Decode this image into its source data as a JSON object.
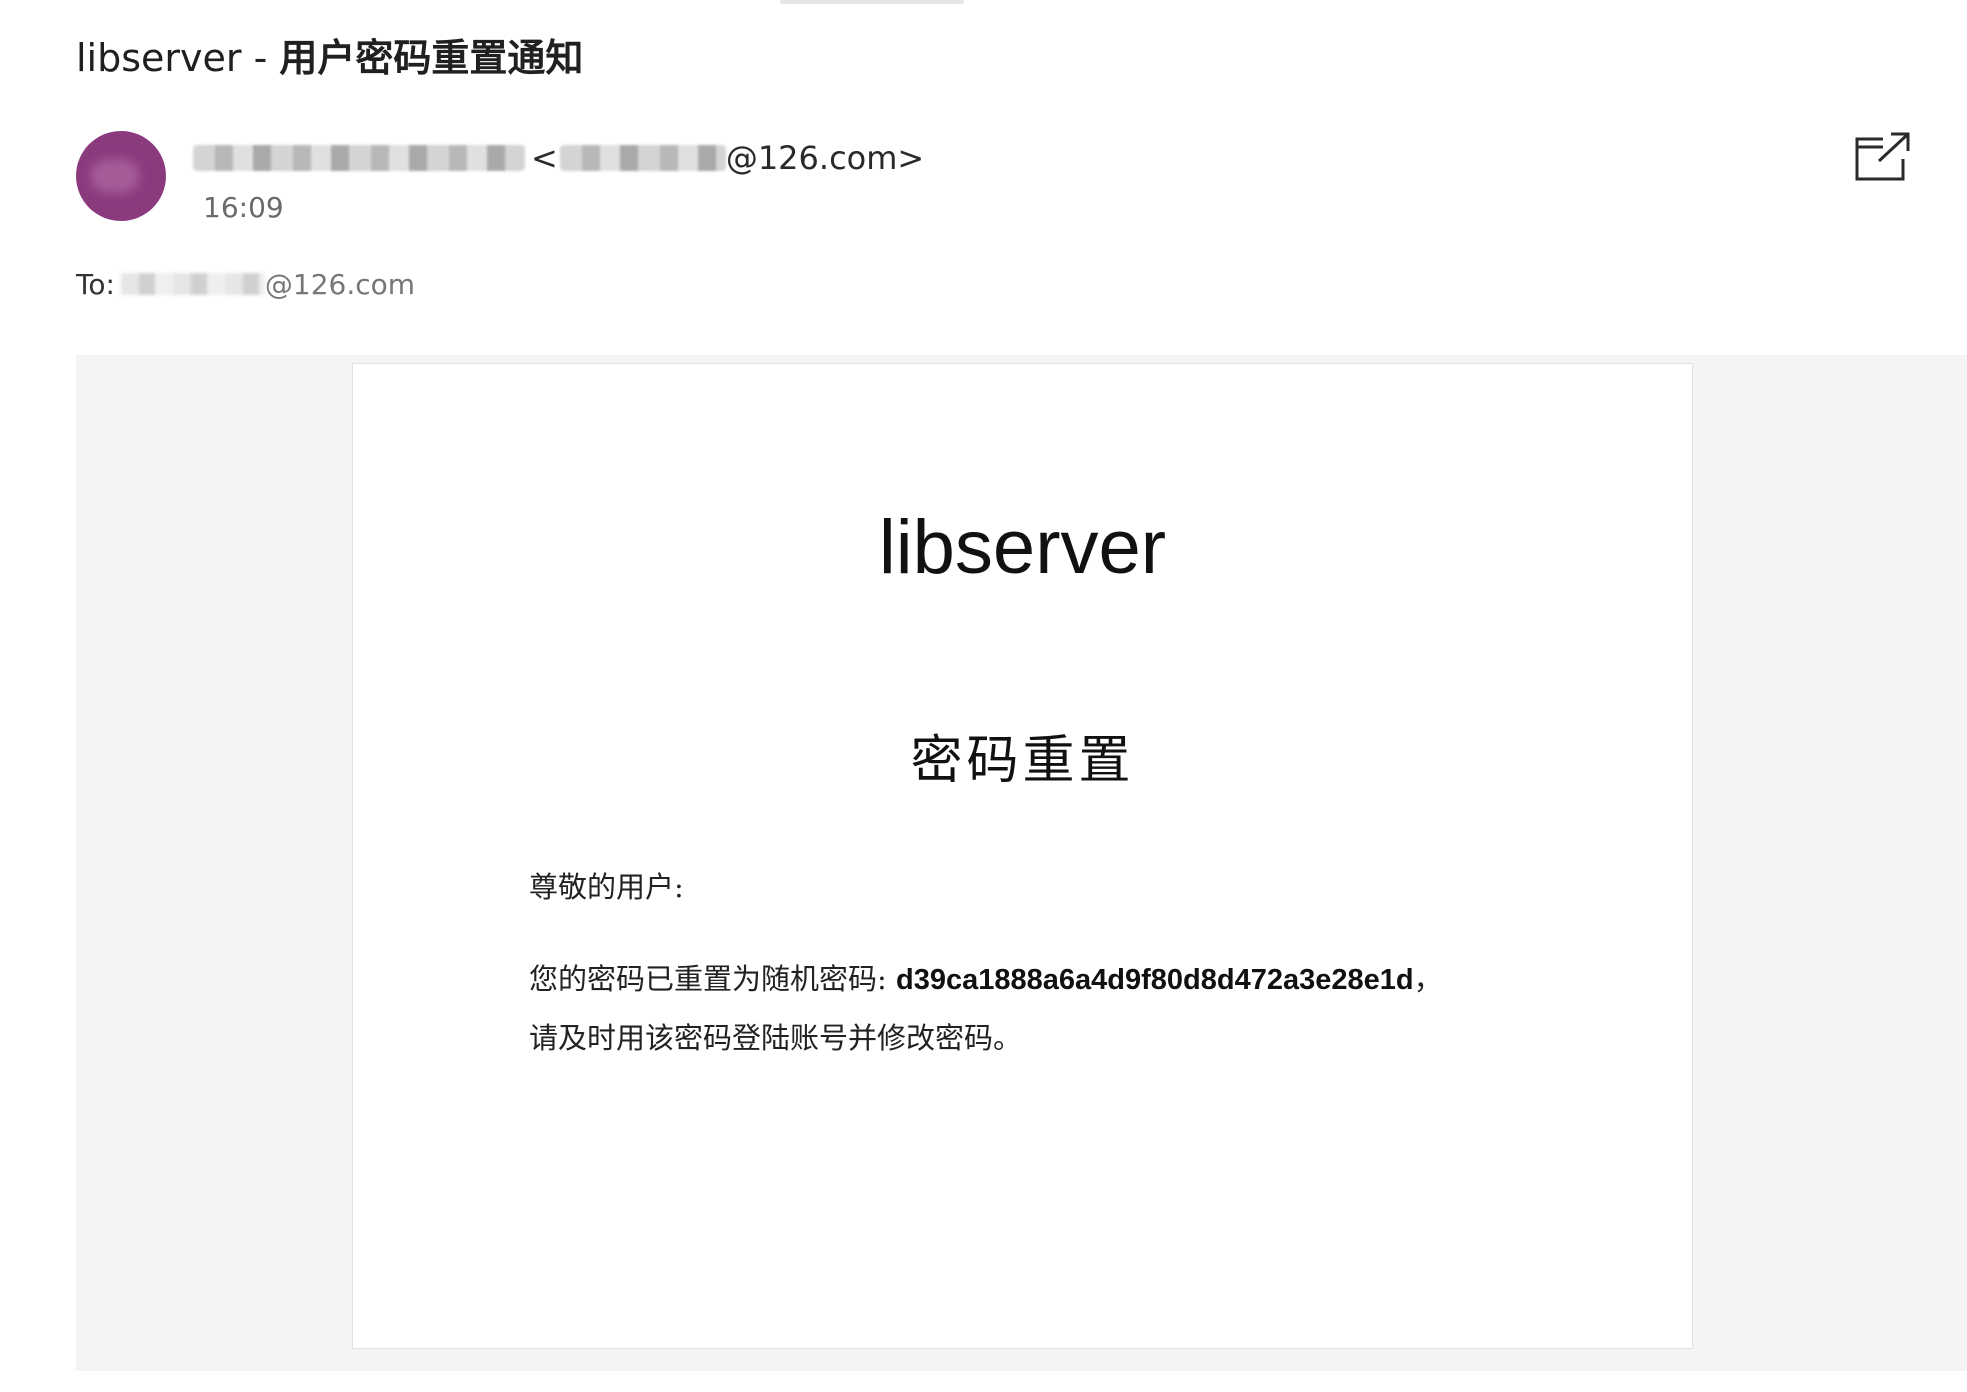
{
  "email": {
    "subject_prefix": "libserver - ",
    "subject_main": "用户密码重置通知",
    "sender": {
      "angle_open": "<",
      "email_domain": "@126.com>"
    },
    "time": "16:09",
    "to": {
      "label": "To: ",
      "email_domain": "@126.com"
    },
    "icons": {
      "popout": "popout-icon"
    }
  },
  "message": {
    "brand": "libserver",
    "heading": "密码重置",
    "greeting": "尊敬的用户:",
    "line1_prefix": "您的密码已重置为随机密码: ",
    "password": "d39ca1888a6a4d9f80d8d472a3e28e1d",
    "line1_suffix": "，",
    "line2": "请及时用该密码登陆账号并修改密码。"
  },
  "colors": {
    "avatar": "#8b3a7e",
    "body_background": "#f4f4f4",
    "card_background": "#ffffff"
  }
}
